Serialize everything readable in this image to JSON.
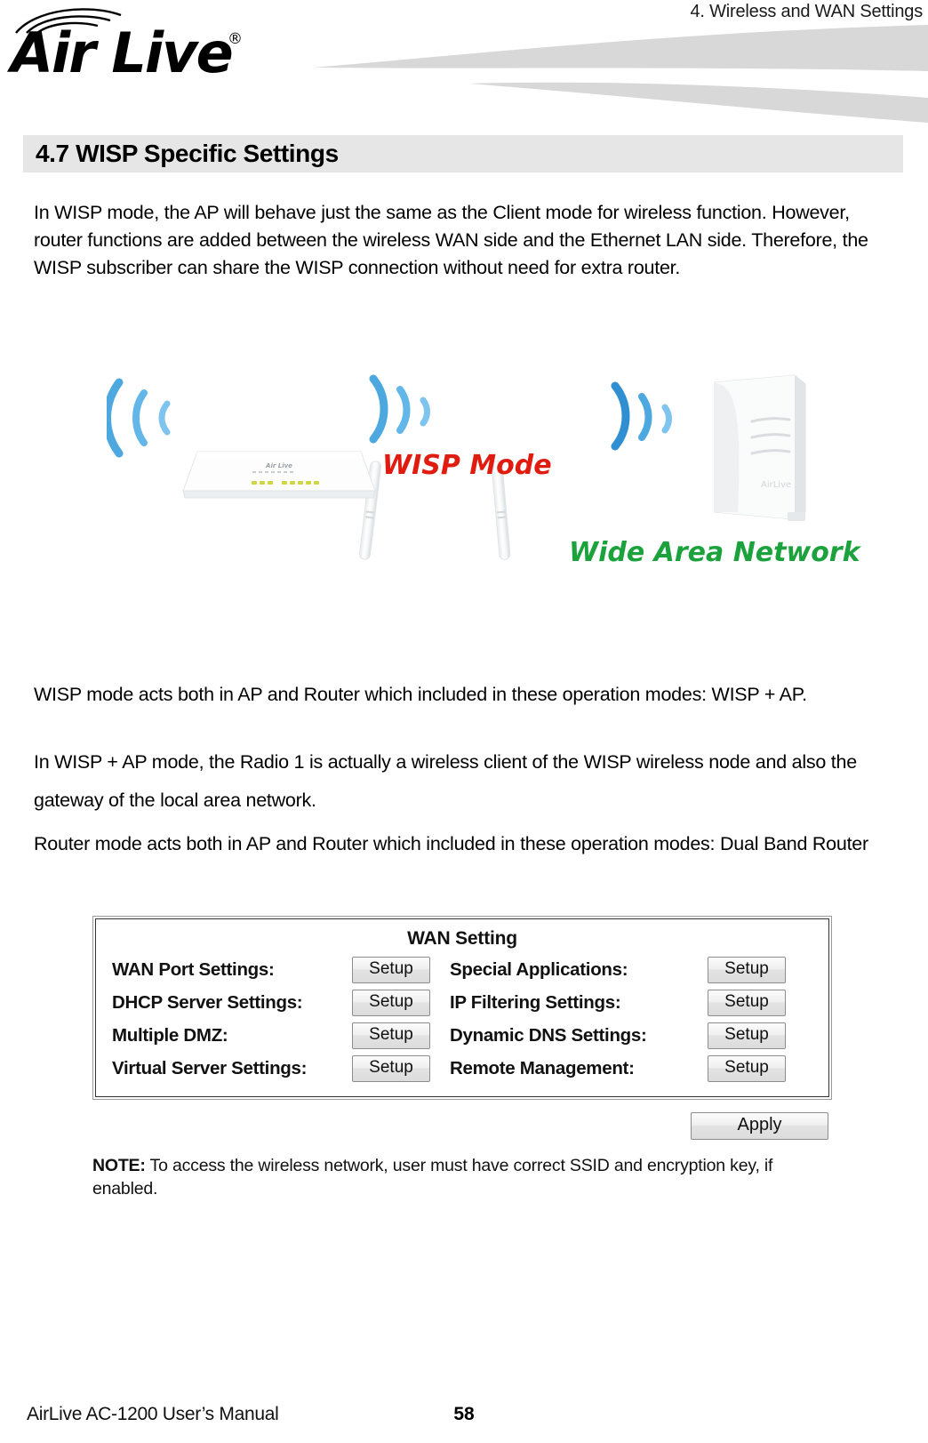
{
  "header": {
    "chapter_title": "4. Wireless and WAN Settings",
    "logo_text": "Air Live",
    "logo_registered": "®"
  },
  "section": {
    "heading": "4.7 WISP Specific Settings"
  },
  "paragraphs": {
    "intro": "In WISP mode, the AP will behave just the same as the Client mode for wireless function. However, router functions are added between the wireless WAN side and the Ethernet LAN side. Therefore, the WISP subscriber can share the WISP connection without need for extra router.",
    "acts": "WISP mode acts both in AP and Router which included in these operation modes: WISP + AP.",
    "radio": "In WISP + AP mode, the Radio 1 is actually a wireless client of the WISP wireless node and also the gateway of the local area network.",
    "router": "Router mode acts both in AP and Router which included in these operation modes: Dual Band Router"
  },
  "diagram": {
    "wisp_mode_label": "WISP Mode",
    "wide_area_network_label": "Wide Area Network",
    "wisp_mode_color": "#e01b10",
    "wide_area_network_color": "#1ba23c",
    "signal_color": "#4da8e0"
  },
  "wan_panel": {
    "title": "WAN Setting",
    "rows": [
      {
        "left_label": "WAN Port Settings:",
        "left_button": "Setup",
        "right_label": "Special Applications:",
        "right_button": "Setup"
      },
      {
        "left_label": "DHCP Server Settings:",
        "left_button": "Setup",
        "right_label": "IP Filtering Settings:",
        "right_button": "Setup"
      },
      {
        "left_label": "Multiple DMZ:",
        "left_button": "Setup",
        "right_label": "Dynamic DNS Settings:",
        "right_button": "Setup"
      },
      {
        "left_label": "Virtual Server Settings:",
        "left_button": "Setup",
        "right_label": "Remote Management:",
        "right_button": "Setup"
      }
    ],
    "apply_button": "Apply",
    "note_prefix": "NOTE:",
    "note_text": " To access the wireless network, user must have correct SSID and encryption key, if enabled."
  },
  "footer": {
    "manual_title": "AirLive AC-1200 User’s Manual",
    "page_number": "58"
  }
}
